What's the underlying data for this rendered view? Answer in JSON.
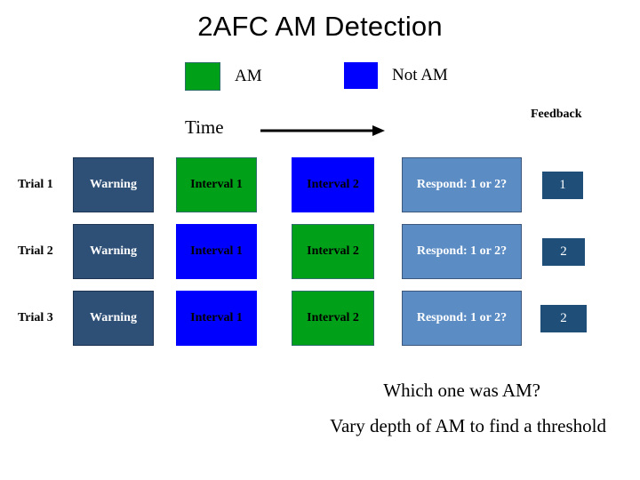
{
  "title": "2AFC AM Detection",
  "legend": {
    "items": [
      {
        "label": "AM",
        "color": "#00A019",
        "kind": "am"
      },
      {
        "label": "Not AM",
        "color": "#0000FF",
        "kind": "not-am"
      }
    ]
  },
  "axis": {
    "time_label": "Time",
    "arrow_direction": "right"
  },
  "feedback_header": "Feedback",
  "columns": {
    "warning": "Warning",
    "interval1": "Interval 1",
    "interval2": "Interval 2",
    "respond": "Respond: 1 or 2?"
  },
  "colors": {
    "warning_box": "#2E5077",
    "am_green": "#00A019",
    "not_am_blue": "#0000FF",
    "respond_box": "#5B8CC4",
    "feedback_box": "#1F4E79",
    "text_light": "#FFFFFF",
    "text_dark": "#000000",
    "background": "#FFFFFF"
  },
  "trials": [
    {
      "label": "Trial 1",
      "warning": "Warning",
      "interval1": {
        "text": "Interval 1",
        "type": "AM"
      },
      "interval2": {
        "text": "Interval 2",
        "type": "Not AM"
      },
      "respond": "Respond: 1 or 2?",
      "feedback": "1"
    },
    {
      "label": "Trial 2",
      "warning": "Warning",
      "interval1": {
        "text": "Interval 1",
        "type": "Not AM"
      },
      "interval2": {
        "text": "Interval 2",
        "type": "AM"
      },
      "respond": "Respond: 1 or 2?",
      "feedback": "2"
    },
    {
      "label": "Trial 3",
      "warning": "Warning",
      "interval1": {
        "text": "Interval 1",
        "type": "Not AM"
      },
      "interval2": {
        "text": "Interval 2",
        "type": "AM"
      },
      "respond": "Respond: 1 or 2?",
      "feedback": "2"
    }
  ],
  "captions": {
    "question": "Which one was AM?",
    "method": "Vary depth of AM to find a threshold"
  }
}
